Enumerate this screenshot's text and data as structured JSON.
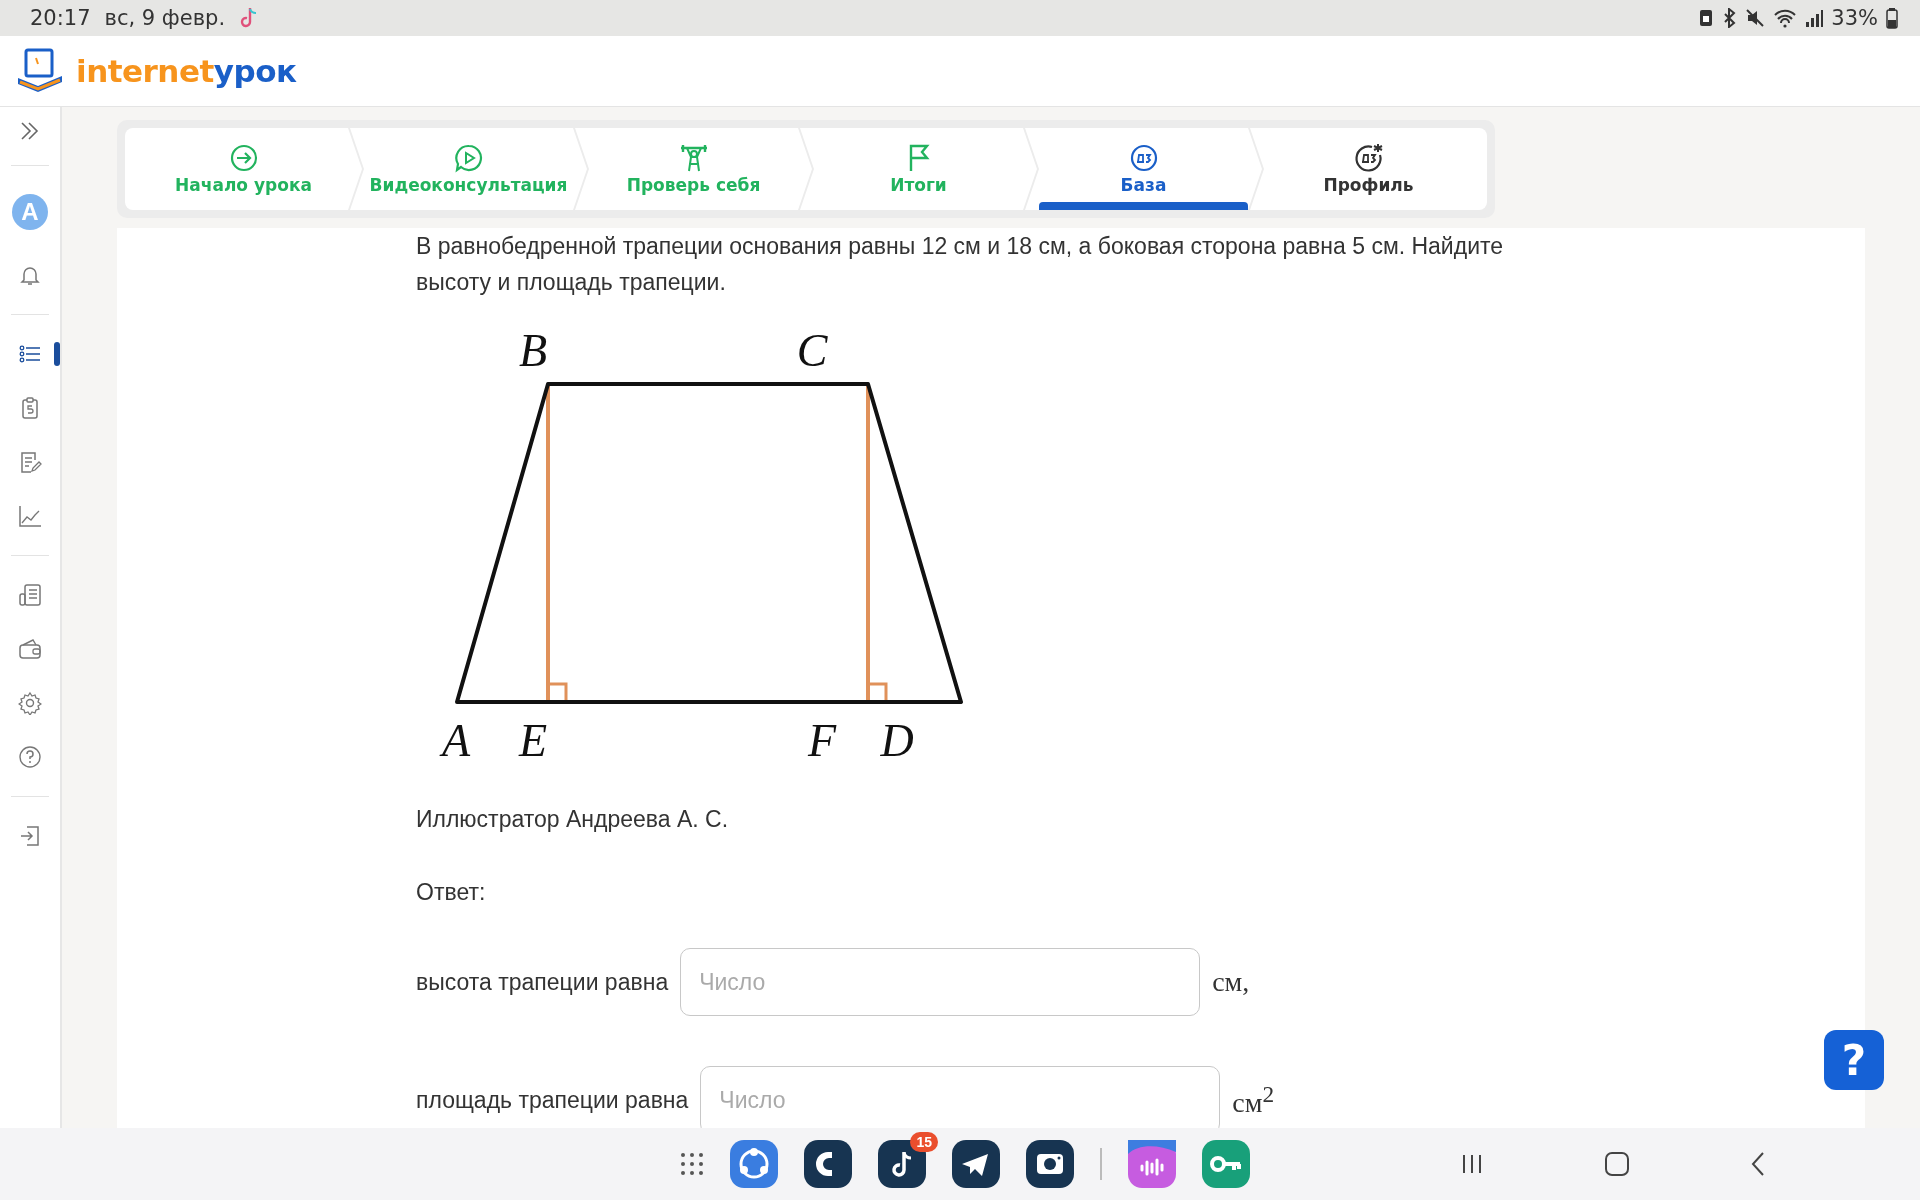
{
  "status_bar": {
    "time": "20:17",
    "date": "вс, 9 февр.",
    "battery": "33%"
  },
  "header": {
    "logo": [
      "internet",
      "урок"
    ]
  },
  "sidebar": {
    "avatar_letter": "A",
    "groups": [
      [
        {
          "kind": "bell",
          "selected": false
        }
      ],
      [
        {
          "kind": "list",
          "selected": true
        },
        {
          "kind": "clipboard",
          "selected": false
        },
        {
          "kind": "edit",
          "selected": false
        },
        {
          "kind": "chart",
          "selected": false
        }
      ],
      [
        {
          "kind": "newspaper",
          "selected": false
        },
        {
          "kind": "wallet",
          "selected": false
        },
        {
          "kind": "gear",
          "selected": false
        },
        {
          "kind": "help",
          "selected": false
        }
      ],
      [
        {
          "kind": "logout",
          "selected": false
        }
      ]
    ]
  },
  "tabs": [
    {
      "label": "Начало урока",
      "color": "#22b35e",
      "selected": false
    },
    {
      "label": "Видеоконсультация",
      "color": "#22b35e",
      "selected": false
    },
    {
      "label": "Проверь себя",
      "color": "#22b35e",
      "selected": false
    },
    {
      "label": "Итоги",
      "color": "#22b35e",
      "selected": false
    },
    {
      "label": "База",
      "color": "#1a5fc8",
      "selected": true
    },
    {
      "label": "Профиль",
      "color": "#333333",
      "selected": false
    }
  ],
  "task": {
    "text": "В равнобедренной трапеции основания равны 12 см и 18 см, а боковая сторона равна 5 см. Найдите высоту и площадь трапеции.",
    "figure_labels": [
      "B",
      "C",
      "A",
      "E",
      "F",
      "D"
    ],
    "credit": "Иллюстратор Андреева А. С.",
    "answer_label": "Ответ:",
    "fields": [
      {
        "label": "высота трапеции равна",
        "placeholder": "Число",
        "unit": "см,"
      },
      {
        "label": "площадь трапеции равна",
        "placeholder": "Число",
        "unit": "см$^{2}$"
      }
    ]
  },
  "help_button": "?",
  "nav_bar": {
    "badge": "15"
  }
}
